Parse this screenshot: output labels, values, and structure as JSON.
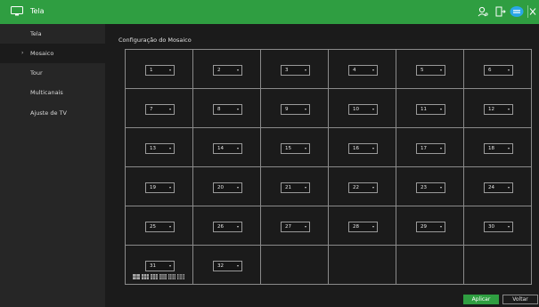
{
  "header": {
    "title": "Tela",
    "icons": [
      "monitor-icon",
      "user-icon",
      "logout-icon",
      "toggle-icon",
      "close-icon"
    ],
    "accent": "#2f9e41"
  },
  "sidebar": {
    "items": [
      {
        "label": "Tela",
        "active": false
      },
      {
        "label": "Mosaico",
        "active": true,
        "arrow": "›"
      },
      {
        "label": "Tour",
        "active": false
      },
      {
        "label": "Multicanais",
        "active": false
      },
      {
        "label": "Ajuste de TV",
        "active": false
      }
    ]
  },
  "main": {
    "section_title": "Configuração do Mosaico",
    "channels": [
      "1",
      "2",
      "3",
      "4",
      "5",
      "6",
      "7",
      "8",
      "9",
      "10",
      "11",
      "12",
      "13",
      "14",
      "15",
      "16",
      "17",
      "18",
      "19",
      "20",
      "21",
      "22",
      "23",
      "24",
      "25",
      "26",
      "27",
      "28",
      "29",
      "30",
      "31",
      "32"
    ],
    "layout_icons": [
      "layout-4-icon",
      "layout-6-icon",
      "layout-9-icon",
      "layout-16-icon",
      "layout-25-icon",
      "layout-36-icon"
    ]
  },
  "buttons": {
    "apply": "Aplicar",
    "back": "Voltar"
  }
}
